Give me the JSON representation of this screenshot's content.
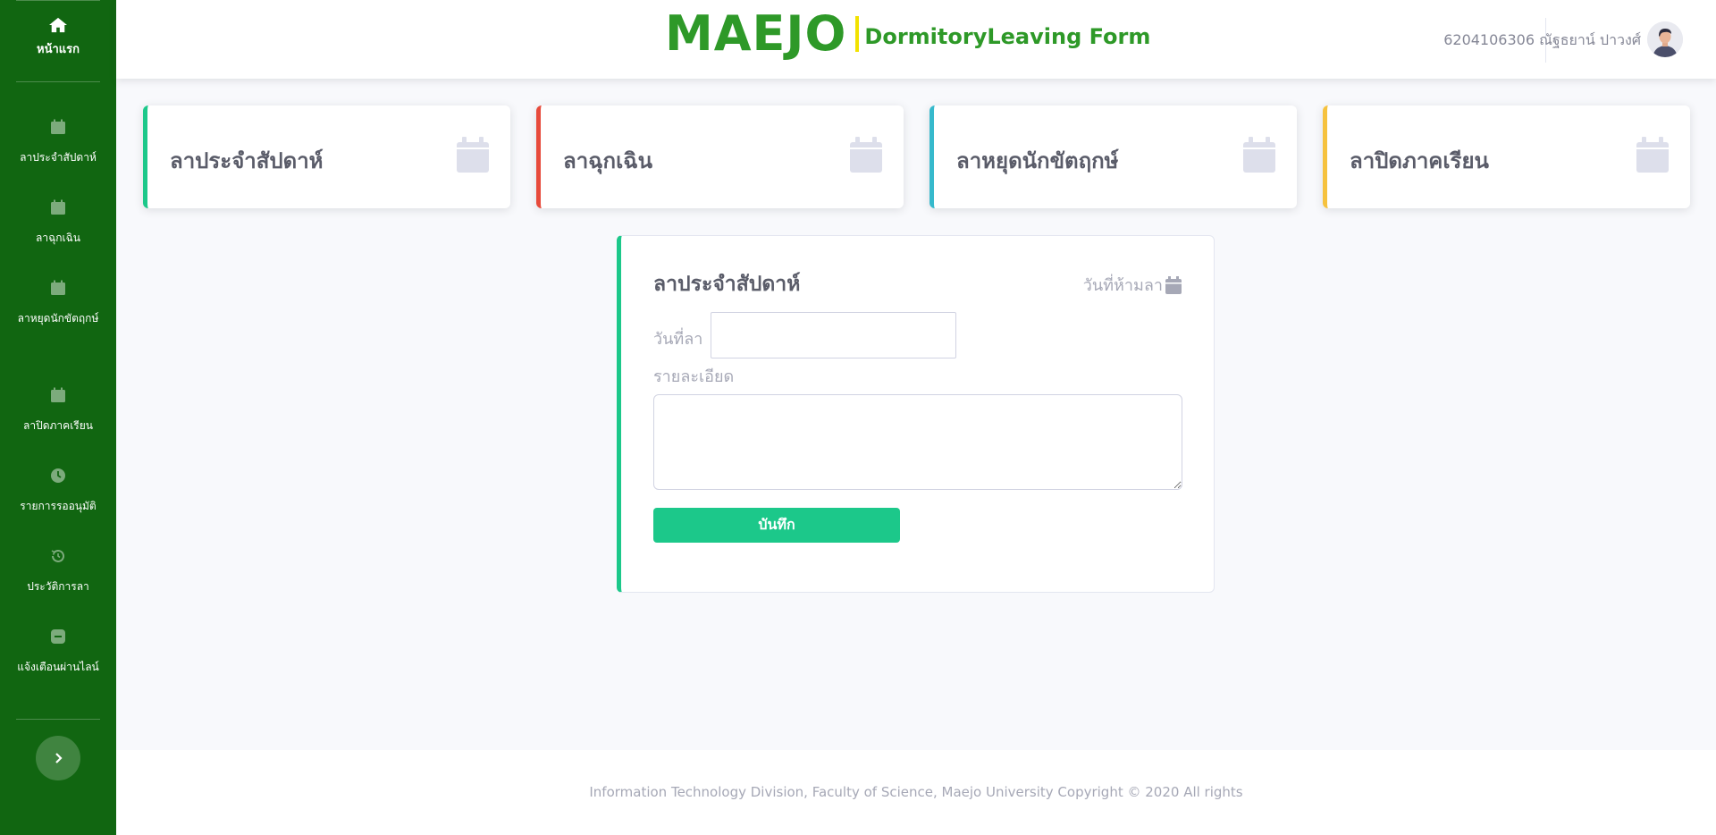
{
  "sidebar": {
    "home": {
      "label": "หน้าแรก",
      "icon": "home-icon"
    },
    "items": [
      {
        "label": "ลาประจำสัปดาห์",
        "icon": "calendar-icon"
      },
      {
        "label": "ลาฉุกเฉิน",
        "icon": "calendar-icon"
      },
      {
        "label": "ลาหยุดนักขัตฤกษ์",
        "icon": "calendar-icon"
      },
      {
        "label": "ลาปิดภาคเรียน",
        "icon": "calendar-icon"
      },
      {
        "label": "รายการรออนุมัติ",
        "icon": "clock-icon"
      },
      {
        "label": "ประวัติการลา",
        "icon": "history-icon"
      },
      {
        "label": "แจ้งเตือนผ่านไลน์",
        "icon": "line-icon"
      }
    ],
    "toggle_icon": "chevron-right-icon"
  },
  "header": {
    "brand": "MAEJO",
    "subtitle": "DormitoryLeaving Form",
    "user": "6204106306 ณัฐธยาน์ ปาวงศ์"
  },
  "cards": [
    {
      "label": "ลาประจำสัปดาห์",
      "color": "#1cc88a"
    },
    {
      "label": "ลาฉุกเฉิน",
      "color": "#e74a3b"
    },
    {
      "label": "ลาหยุดนักขัตฤกษ์",
      "color": "#36b9cc"
    },
    {
      "label": "ลาปิดภาคเรียน",
      "color": "#f6c23e"
    }
  ],
  "form": {
    "title": "ลาประจำสัปดาห์",
    "forbidden_link": "วันที่ห้ามลา",
    "date_label": "วันที่ลา",
    "date_value": "",
    "detail_label": "รายละเอียด",
    "detail_value": "",
    "save_label": "บันทึก"
  },
  "footer": {
    "text": "Information Technology Division, Faculty of Science, Maejo University Copyright © 2020 All rights"
  },
  "colors": {
    "sidebar": "#116611",
    "brand": "#2e9928",
    "brand_bar": "#f2e200",
    "save_button": "#1cc88a"
  }
}
